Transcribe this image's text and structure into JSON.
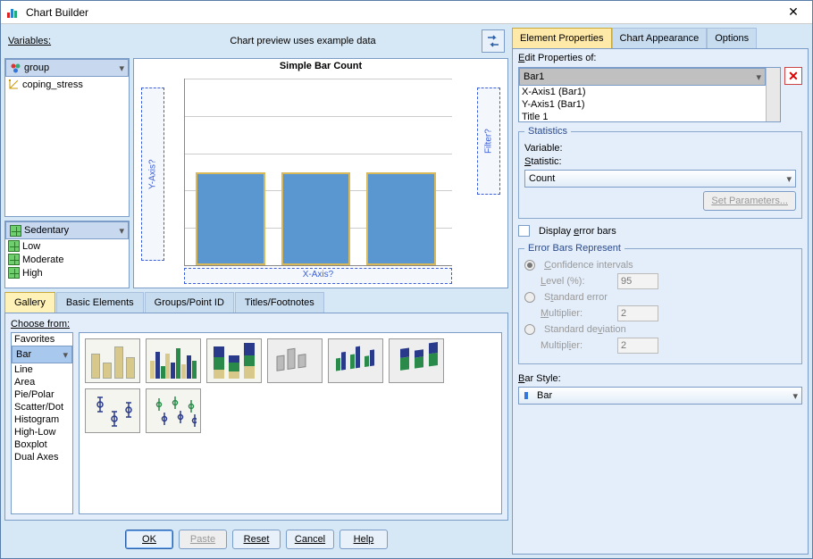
{
  "window": {
    "title": "Chart Builder"
  },
  "left": {
    "variables_label": "Variables:",
    "preview_label": "Chart preview uses example data",
    "vars": [
      {
        "name": "group",
        "icon": "nominal"
      },
      {
        "name": "coping_stress",
        "icon": "scale"
      }
    ],
    "categories": [
      "Sedentary",
      "Low",
      "Moderate",
      "High"
    ],
    "chart": {
      "title": "Simple Bar Count",
      "xaxis_drop": "X-Axis?",
      "yaxis_drop": "Y-Axis?",
      "filter_drop": "Filter?"
    },
    "tabs": [
      "Gallery",
      "Basic Elements",
      "Groups/Point ID",
      "Titles/Footnotes"
    ],
    "gallery": {
      "choose_label": "Choose from:",
      "types": [
        "Favorites",
        "Bar",
        "Line",
        "Area",
        "Pie/Polar",
        "Scatter/Dot",
        "Histogram",
        "High-Low",
        "Boxplot",
        "Dual Axes"
      ],
      "selected": "Bar"
    },
    "buttons": {
      "ok": "OK",
      "paste": "Paste",
      "reset": "Reset",
      "cancel": "Cancel",
      "help": "Help"
    }
  },
  "right": {
    "tabs": [
      "Element Properties",
      "Chart Appearance",
      "Options"
    ],
    "edit_label": "Edit Properties of:",
    "edit_items": [
      "Bar1",
      "X-Axis1 (Bar1)",
      "Y-Axis1 (Bar1)",
      "Title 1"
    ],
    "statistics": {
      "legend": "Statistics",
      "variable_label": "Variable:",
      "statistic_label": "Statistic:",
      "statistic_value": "Count",
      "set_params": "Set Parameters..."
    },
    "errorbars": {
      "display_label": "Display error bars",
      "legend": "Error Bars Represent",
      "ci_label": "Confidence intervals",
      "ci_level_label": "Level (%):",
      "ci_level_value": "95",
      "se_label": "Standard error",
      "se_mult_label": "Multiplier:",
      "se_mult_value": "2",
      "sd_label": "Standard deviation",
      "sd_mult_label": "Multiplier:",
      "sd_mult_value": "2"
    },
    "barstyle": {
      "label": "Bar Style:",
      "value": "Bar"
    }
  },
  "chart_data": {
    "type": "bar",
    "title": "Simple Bar Count",
    "categories": [
      "",
      "",
      ""
    ],
    "values": [
      50,
      50,
      50
    ],
    "ylim": [
      0,
      100
    ],
    "xlabel": "X-Axis?",
    "ylabel": "Y-Axis?"
  }
}
